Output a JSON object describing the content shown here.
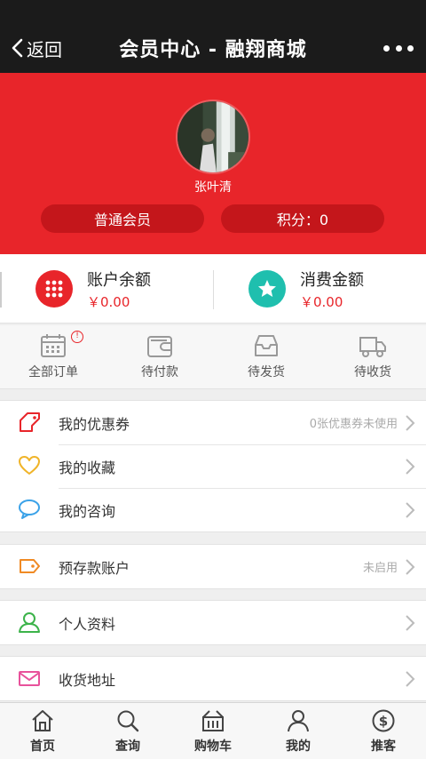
{
  "header": {
    "back_label": "返回",
    "title": "会员中心 - 融翔商城"
  },
  "profile": {
    "username": "张叶清",
    "level_label": "普通会员",
    "points_label": "积分：0"
  },
  "balance": {
    "account_label": "账户余额",
    "account_value": "￥0.00",
    "spend_label": "消费金额",
    "spend_value": "￥0.00"
  },
  "orders": [
    {
      "label": "全部订单",
      "icon": "calendar-icon"
    },
    {
      "label": "待付款",
      "icon": "wallet-icon"
    },
    {
      "label": "待发货",
      "icon": "inbox-icon"
    },
    {
      "label": "待收货",
      "icon": "truck-icon"
    }
  ],
  "menu_group_1": [
    {
      "label": "我的优惠券",
      "hint": "0张优惠券未使用",
      "icon": "coupon-icon"
    },
    {
      "label": "我的收藏",
      "hint": "",
      "icon": "heart-icon"
    },
    {
      "label": "我的咨询",
      "hint": "",
      "icon": "chat-bubble-icon"
    }
  ],
  "menu_group_2": [
    {
      "label": "预存款账户",
      "hint": "未启用",
      "icon": "tag-icon"
    }
  ],
  "menu_group_3": [
    {
      "label": "个人资料",
      "hint": "",
      "icon": "person-icon"
    }
  ],
  "menu_group_4": [
    {
      "label": "收货地址",
      "hint": "",
      "icon": "envelope-icon"
    }
  ],
  "tabbar": [
    {
      "label": "首页",
      "icon": "home-icon"
    },
    {
      "label": "查询",
      "icon": "search-icon"
    },
    {
      "label": "购物车",
      "icon": "cart-icon"
    },
    {
      "label": "我的",
      "icon": "user-icon"
    },
    {
      "label": "推客",
      "icon": "dollar-icon"
    }
  ],
  "colors": {
    "brand_red": "#e8252a",
    "nav_bg": "#1b1b1b",
    "teal": "#1fbfae"
  }
}
